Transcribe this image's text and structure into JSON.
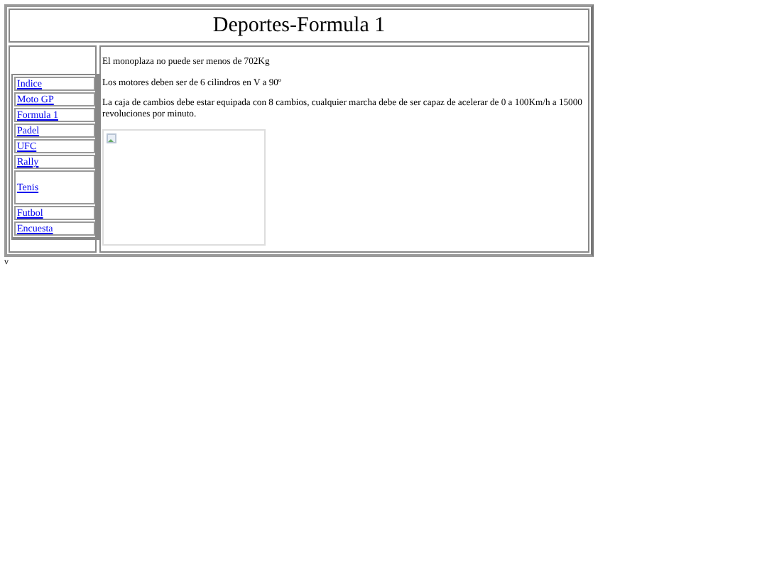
{
  "header": {
    "title": "Deportes-Formula 1"
  },
  "nav": {
    "items": [
      {
        "label": "Indice",
        "kind": "normal"
      },
      {
        "label": "Moto GP",
        "kind": "normal"
      },
      {
        "label": "Formula 1",
        "kind": "normal"
      },
      {
        "label": "Padel",
        "kind": "normal"
      },
      {
        "label": "UFC",
        "kind": "normal"
      },
      {
        "label": "Rally",
        "kind": "normal"
      },
      {
        "label": "Tenis",
        "kind": "tall"
      },
      {
        "label": "Futbol",
        "kind": "normal"
      },
      {
        "label": "Encuesta",
        "kind": "normal"
      }
    ]
  },
  "content": {
    "paragraphs": [
      "El monoplaza no puede ser menos de 702Kg",
      "Los motores deben ser de 6 cilindros en V a 90º",
      "La caja de cambios debe estar equipada con 8 cambios, cualquier marcha debe de ser capaz de acelerar de 0 a 100Km/h a 15000 revoluciones por minuto."
    ]
  },
  "footer": {
    "text": "v"
  }
}
